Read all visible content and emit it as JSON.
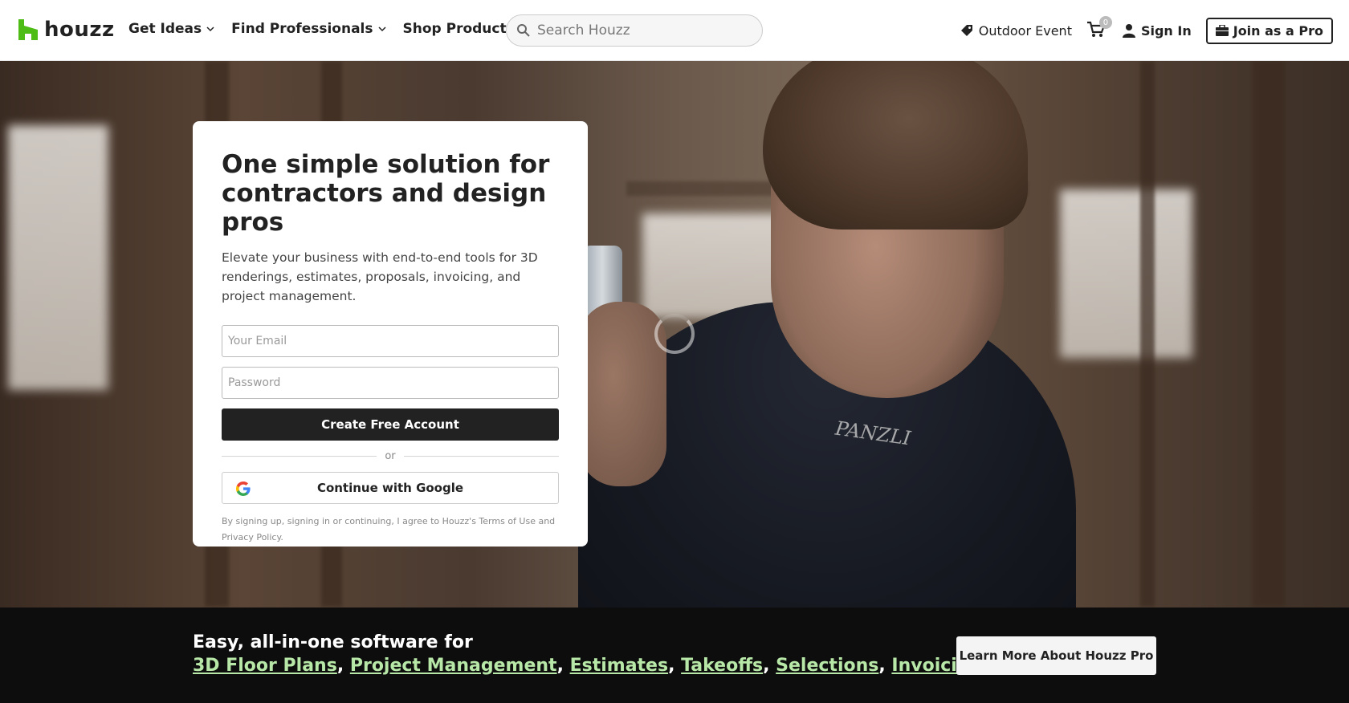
{
  "brand": {
    "name": "houzz",
    "color": "#4DBC15"
  },
  "nav": {
    "items": [
      {
        "label": "Get Ideas"
      },
      {
        "label": "Find Professionals"
      },
      {
        "label": "Shop Products"
      }
    ]
  },
  "search": {
    "placeholder": "Search Houzz"
  },
  "right_nav": {
    "event_label": "Outdoor Event",
    "cart_count": "0",
    "sign_in": "Sign In",
    "join_pro": "Join as a Pro"
  },
  "signup_card": {
    "title": "One simple solution for contractors and design pros",
    "description": "Elevate your business with end-to-end tools for 3D renderings, estimates, proposals, invoicing, and project management.",
    "email_placeholder": "Your Email",
    "password_placeholder": "Password",
    "create_button": "Create Free Account",
    "divider_text": "or",
    "google_button": "Continue with Google",
    "legal_text": "By signing up, signing in or continuing, I agree to Houzz's Terms of Use and Privacy Policy."
  },
  "hero_image": {
    "shirt_print": "PANZLI"
  },
  "footer_band": {
    "title": "Easy, all-in-one software for",
    "links": [
      "3D Floor Plans",
      "Project Management",
      "Estimates",
      "Takeoffs",
      "Selections",
      "Invoicing"
    ],
    "separator": ",",
    "link_color": "#B8E8A8",
    "cta_button": "Learn More About Houzz Pro"
  }
}
